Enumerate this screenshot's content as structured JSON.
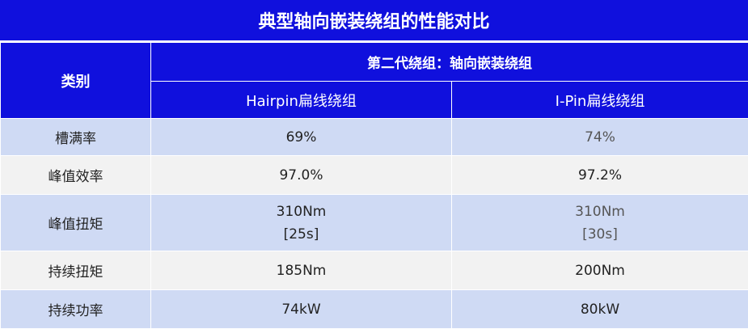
{
  "title": "典型轴向嵌装绕组的性能对比",
  "header": {
    "category": "类别",
    "group": "第二代绕组：轴向嵌装绕组",
    "col1": "Hairpin扁线绕组",
    "col2": "I-Pin扁线绕组"
  },
  "rows": [
    {
      "label": "槽满率",
      "v1": "69%",
      "v2": "74%"
    },
    {
      "label": "峰值效率",
      "v1": "97.0%",
      "v2": "97.2%"
    },
    {
      "label": "峰值扭矩",
      "v1": "310Nm",
      "v1b": "[25s]",
      "v2": "310Nm",
      "v2b": "[30s]"
    },
    {
      "label": "持续扭矩",
      "v1": "185Nm",
      "v2": "200Nm"
    },
    {
      "label": "持续功率",
      "v1": "74kW",
      "v2": "80kW"
    }
  ],
  "colors": {
    "header_bg": "#1010dd",
    "row_blue": "#cfdaf4",
    "row_gray": "#f2f2f2"
  }
}
